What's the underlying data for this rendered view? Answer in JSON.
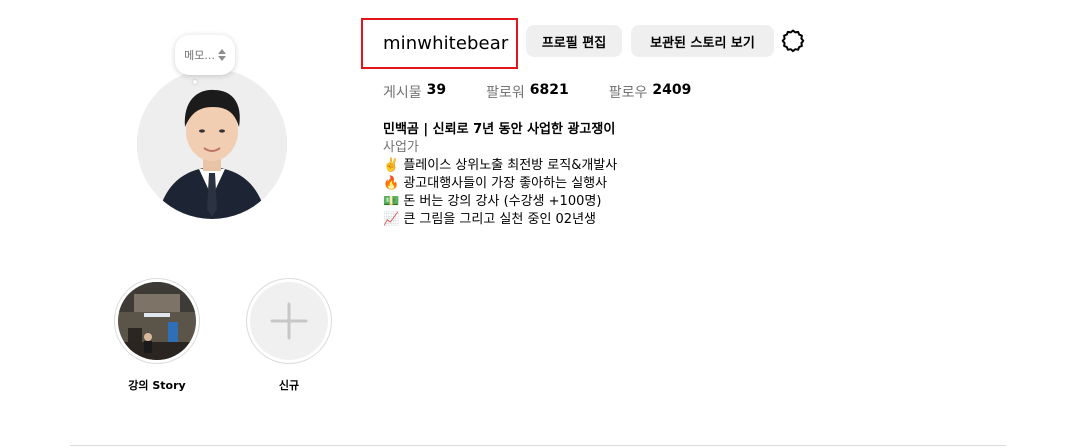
{
  "profile": {
    "username": "minwhitebear",
    "memo_label": "메모...",
    "edit_profile_label": "프로필 편집",
    "archive_label": "보관된 스토리 보기"
  },
  "stats": [
    {
      "label": "게시물",
      "value": "39"
    },
    {
      "label": "팔로워",
      "value": "6821"
    },
    {
      "label": "팔로우",
      "value": "2409"
    }
  ],
  "bio": {
    "name": "민백곰 | 신뢰로 7년 동안 사업한 광고쟁이",
    "category": "사업가",
    "lines": [
      "✌️ 플레이스 상위노출 최전방 로직&개발사",
      "🔥 광고대행사들이 가장 좋아하는 실행사",
      "💵 돈 버는 강의 강사 (수강생 +100명)",
      "📈 큰 그림을 그리고 실천 중인 02년생"
    ]
  },
  "highlights": [
    {
      "label": "강의 Story"
    },
    {
      "label": "신규"
    }
  ],
  "colors": {
    "annotation_box": "#e3161e",
    "button_bg": "#efefef",
    "secondary_text": "#737373"
  }
}
